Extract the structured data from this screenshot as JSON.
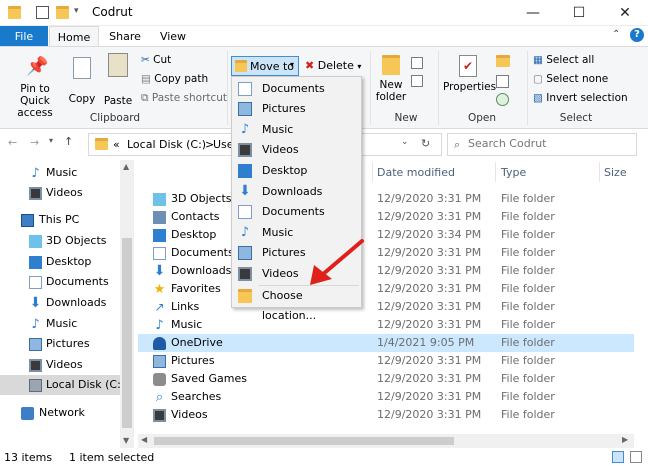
{
  "window": {
    "title": "Codrut",
    "minimize": "—",
    "maximize": "☐",
    "close": "✕"
  },
  "ribbon_tabs": {
    "file": "File",
    "home": "Home",
    "share": "Share",
    "view": "View"
  },
  "ribbon": {
    "pin": "Pin to Quick access",
    "copy": "Copy",
    "paste": "Paste",
    "cut": "Cut",
    "copy_path": "Copy path",
    "paste_shortcut": "Paste shortcut",
    "clipboard": "Clipboard",
    "move_to": "Move to",
    "delete": "Delete",
    "new_folder": "New folder",
    "new_group": "New",
    "properties": "Properties",
    "open_group": "Open",
    "select_all": "Select all",
    "select_none": "Select none",
    "invert_selection": "Invert selection",
    "select_group": "Select"
  },
  "address": {
    "prefix": "«",
    "path1": "Local Disk (C:)",
    "sep": ">",
    "path2": "User"
  },
  "search": {
    "placeholder": "Search Codrut"
  },
  "nav_items": [
    {
      "label": "Music",
      "icon": "music-icon"
    },
    {
      "label": "Videos",
      "icon": "videos-icon"
    },
    {
      "label": "This PC",
      "icon": "this-pc-icon"
    },
    {
      "label": "3D Objects",
      "icon": "3d-objects-icon"
    },
    {
      "label": "Desktop",
      "icon": "desktop-icon"
    },
    {
      "label": "Documents",
      "icon": "documents-icon"
    },
    {
      "label": "Downloads",
      "icon": "downloads-icon"
    },
    {
      "label": "Music",
      "icon": "music-icon"
    },
    {
      "label": "Pictures",
      "icon": "pictures-icon"
    },
    {
      "label": "Videos",
      "icon": "videos-icon"
    },
    {
      "label": "Local Disk (C:)",
      "icon": "disk-icon"
    },
    {
      "label": "Network",
      "icon": "network-icon"
    }
  ],
  "columns": {
    "name": "",
    "date": "Date modified",
    "type": "Type",
    "size": "Size"
  },
  "files": [
    {
      "name": "3D Objects",
      "date": "12/9/2020 3:31 PM",
      "type": "File folder"
    },
    {
      "name": "Contacts",
      "date": "12/9/2020 3:31 PM",
      "type": "File folder"
    },
    {
      "name": "Desktop",
      "date": "12/9/2020 3:34 PM",
      "type": "File folder"
    },
    {
      "name": "Documents",
      "date": "12/9/2020 3:31 PM",
      "type": "File folder"
    },
    {
      "name": "Downloads",
      "date": "12/9/2020 3:31 PM",
      "type": "File folder"
    },
    {
      "name": "Favorites",
      "date": "12/9/2020 3:31 PM",
      "type": "File folder"
    },
    {
      "name": "Links",
      "date": "12/9/2020 3:31 PM",
      "type": "File folder"
    },
    {
      "name": "Music",
      "date": "12/9/2020 3:31 PM",
      "type": "File folder"
    },
    {
      "name": "OneDrive",
      "date": "1/4/2021 9:05 PM",
      "type": "File folder"
    },
    {
      "name": "Pictures",
      "date": "12/9/2020 3:31 PM",
      "type": "File folder"
    },
    {
      "name": "Saved Games",
      "date": "12/9/2020 3:31 PM",
      "type": "File folder"
    },
    {
      "name": "Searches",
      "date": "12/9/2020 3:31 PM",
      "type": "File folder"
    },
    {
      "name": "Videos",
      "date": "12/9/2020 3:31 PM",
      "type": "File folder"
    }
  ],
  "menu_items": [
    "Documents",
    "Pictures",
    "Music",
    "Videos",
    "Desktop",
    "Downloads",
    "Documents",
    "Music",
    "Pictures",
    "Videos"
  ],
  "menu_choose": "Choose location...",
  "status": {
    "count": "13 items",
    "selected": "1 item selected"
  },
  "colors": {
    "accent": "#1979ca",
    "selection": "#cce8ff",
    "arrow": "#e0201a"
  }
}
